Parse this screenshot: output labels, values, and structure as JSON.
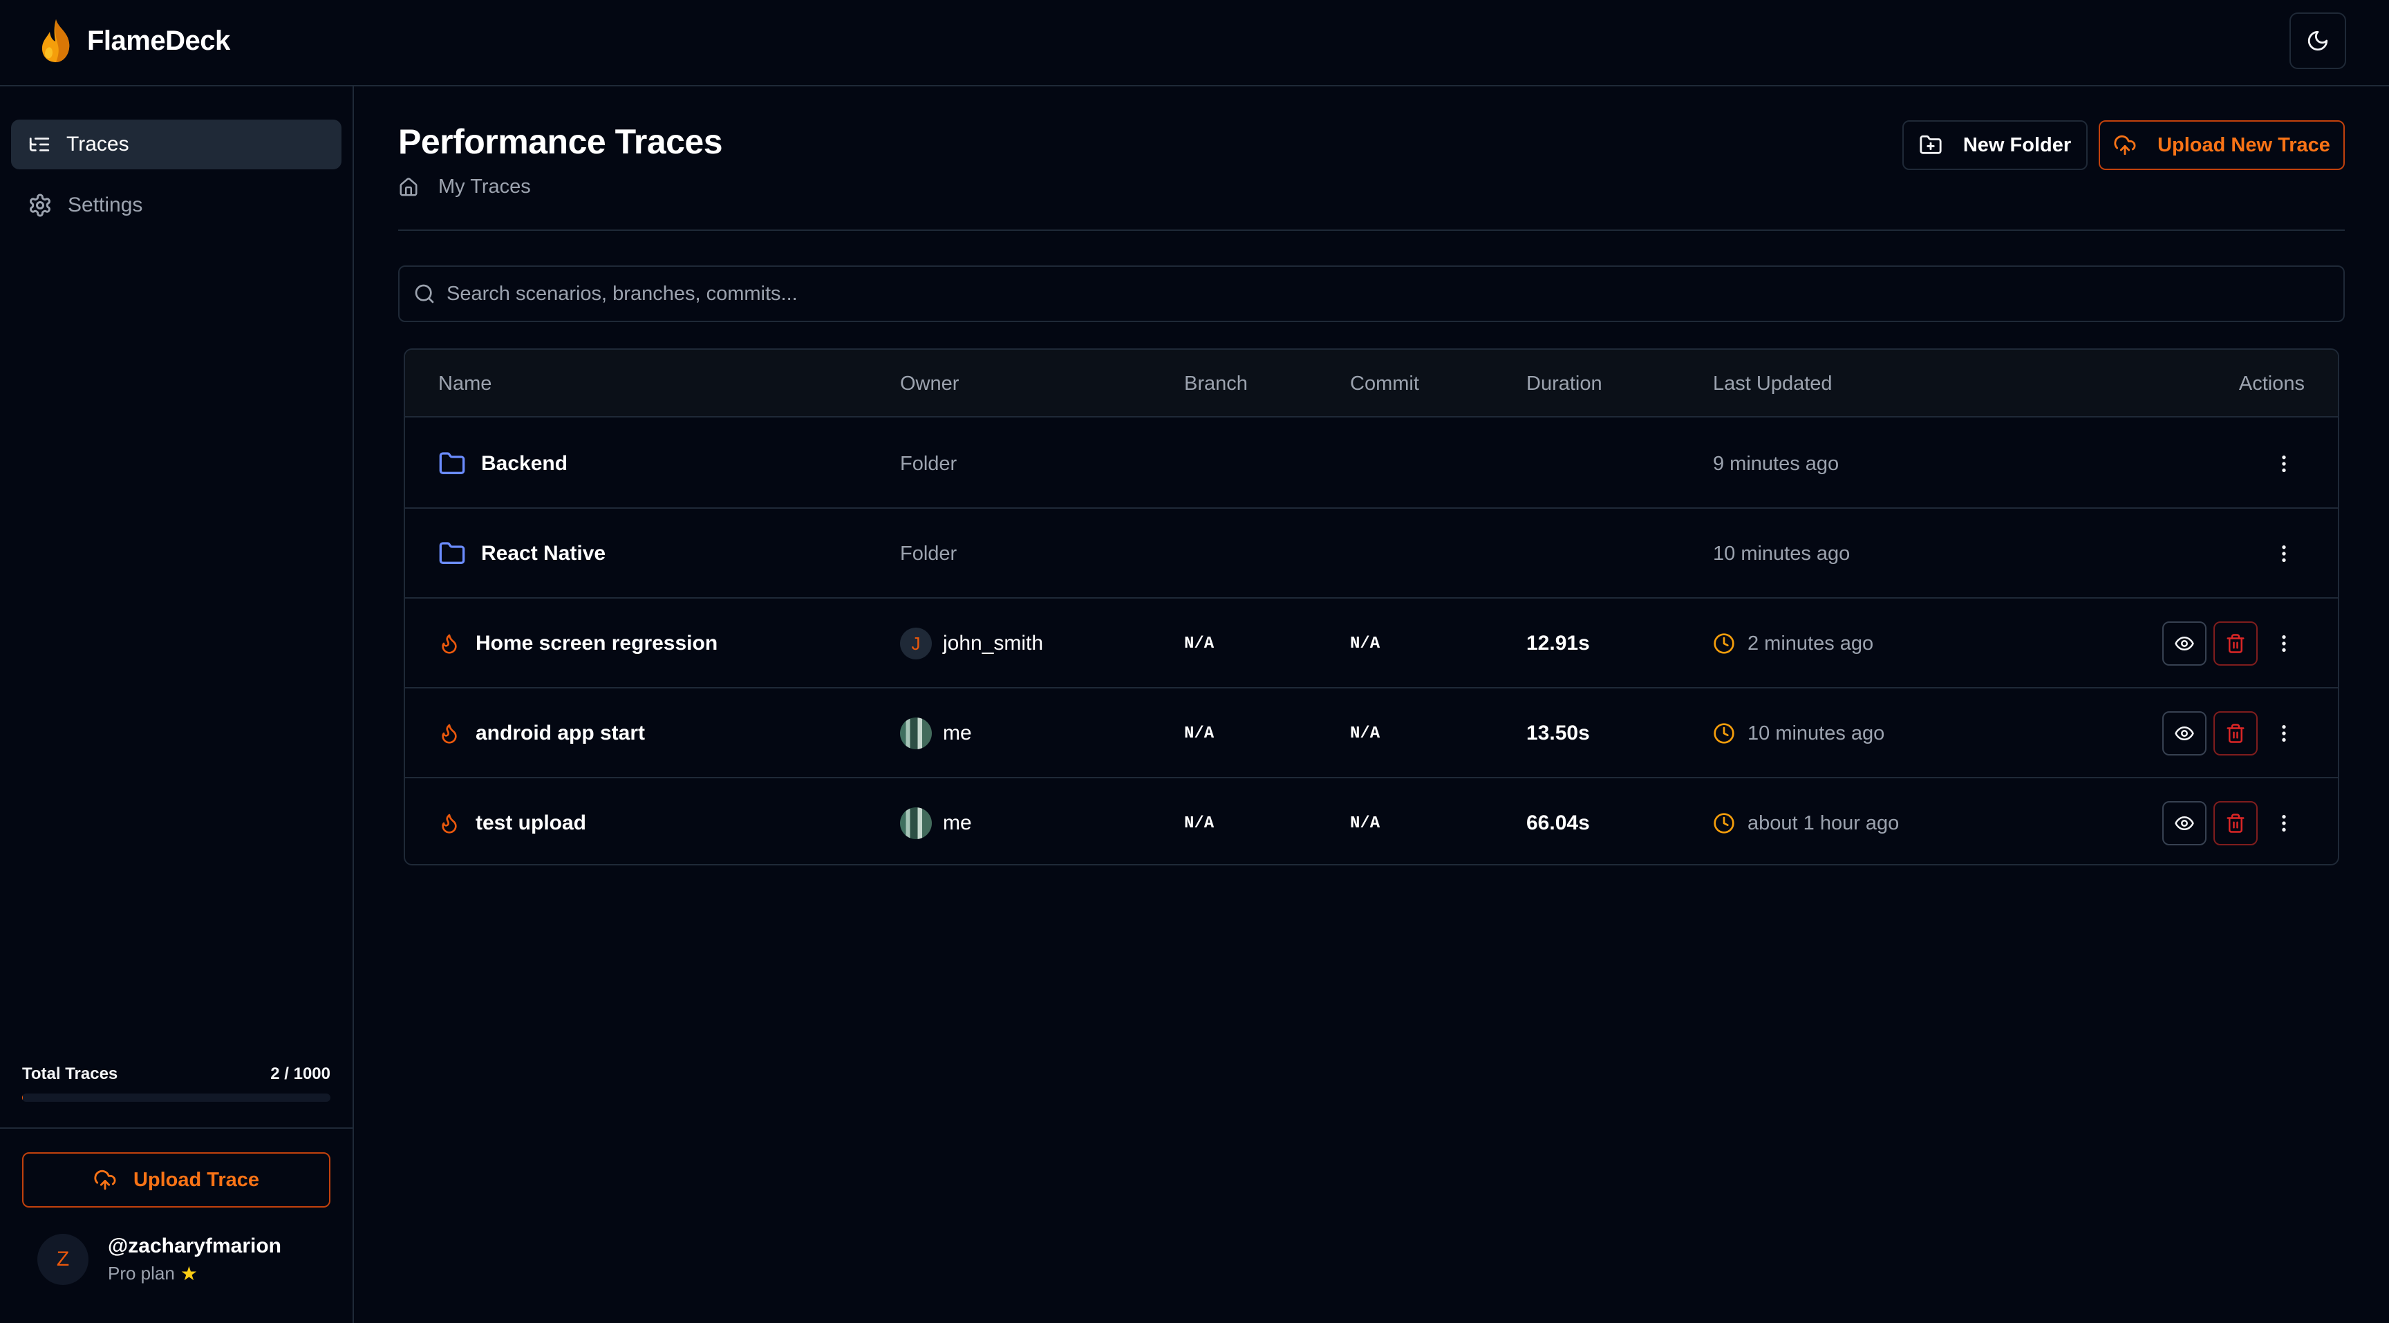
{
  "app": {
    "name": "FlameDeck"
  },
  "sidebar": {
    "nav": [
      {
        "label": "Traces",
        "icon": "list-tree-icon",
        "active": true
      },
      {
        "label": "Settings",
        "icon": "gear-icon",
        "active": false
      }
    ],
    "quota": {
      "label": "Total Traces",
      "value_text": "2 / 1000",
      "used": 2,
      "limit": 1000
    },
    "upload_label": "Upload Trace",
    "user": {
      "initial": "Z",
      "handle": "@zacharyfmarion",
      "plan": "Pro plan"
    }
  },
  "main": {
    "title": "Performance Traces",
    "breadcrumb": "My Traces",
    "new_folder_label": "New Folder",
    "upload_new_label": "Upload New Trace",
    "search": {
      "placeholder": "Search scenarios, branches, commits...",
      "value": ""
    },
    "table": {
      "headers": [
        "Name",
        "Owner",
        "Branch",
        "Commit",
        "Duration",
        "Last Updated",
        "Actions"
      ],
      "rows": [
        {
          "type": "folder",
          "name": "Backend",
          "owner": "Folder",
          "branch": "",
          "commit": "",
          "duration": "",
          "updated": "9 minutes ago"
        },
        {
          "type": "folder",
          "name": "React Native",
          "owner": "Folder",
          "branch": "",
          "commit": "",
          "duration": "",
          "updated": "10 minutes ago"
        },
        {
          "type": "trace",
          "name": "Home screen regression",
          "owner": "john_smith",
          "owner_initial": "J",
          "branch": "N/A",
          "commit": "N/A",
          "duration": "12.91s",
          "updated": "2 minutes ago"
        },
        {
          "type": "trace",
          "name": "android app start",
          "owner": "me",
          "branch": "N/A",
          "commit": "N/A",
          "duration": "13.50s",
          "updated": "10 minutes ago"
        },
        {
          "type": "trace",
          "name": "test upload",
          "owner": "me",
          "branch": "N/A",
          "commit": "N/A",
          "duration": "66.04s",
          "updated": "about 1 hour ago"
        }
      ]
    }
  },
  "colors": {
    "background": "#030712",
    "accent": "#f97316",
    "folder": "#6b8cff",
    "danger": "#dc2626",
    "clock": "#f59e0b"
  }
}
